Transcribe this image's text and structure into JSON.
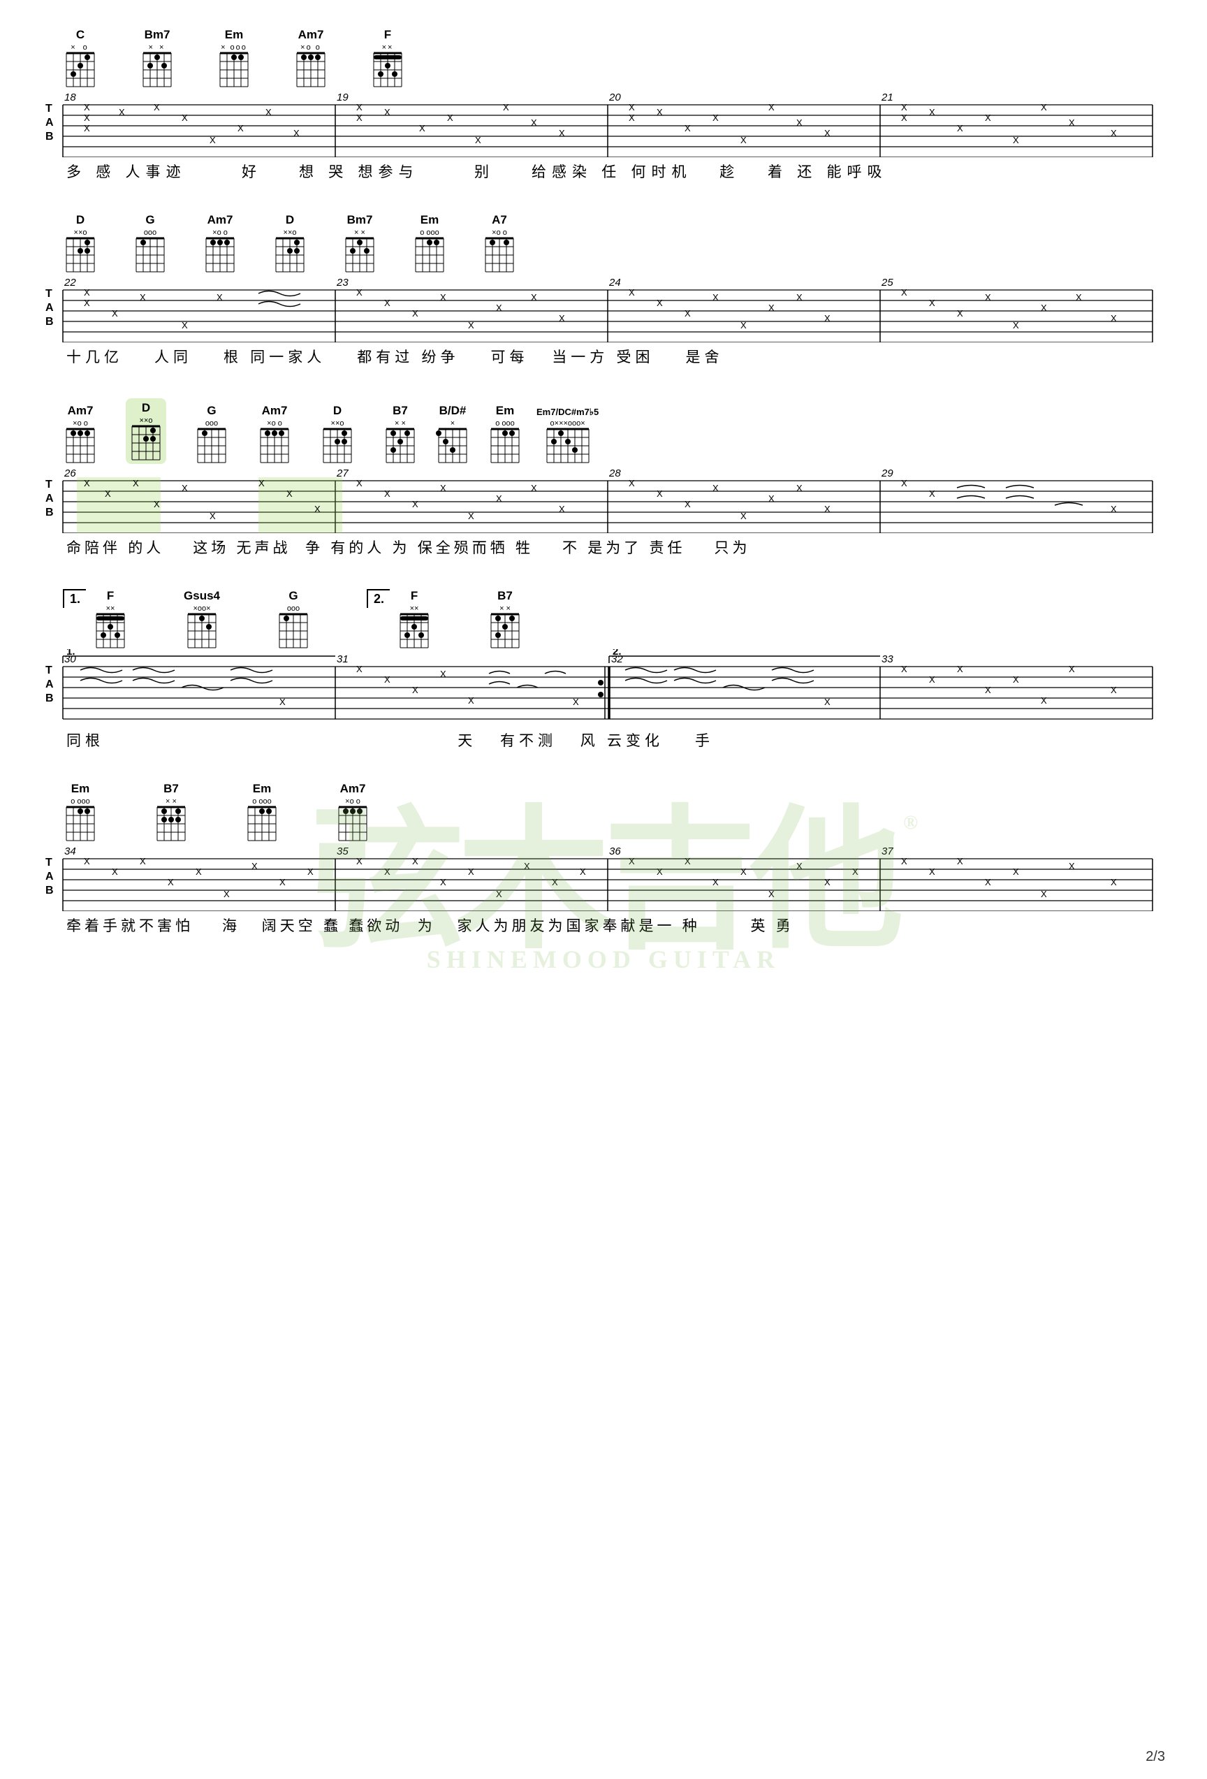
{
  "page": {
    "number": "2/3",
    "background": "#ffffff"
  },
  "watermark": {
    "big_text": "弦木吉他",
    "small_text": "SHINEMOOD GUITAR",
    "registered": "®"
  },
  "sections": [
    {
      "id": "section1",
      "chords": [
        {
          "name": "C",
          "markers": "×  o",
          "fret_marker": "",
          "position": "left"
        },
        {
          "name": "Bm7",
          "markers": "× ×",
          "fret_marker": "",
          "position": ""
        },
        {
          "name": "Em",
          "markers": "× ooo",
          "fret_marker": "",
          "position": ""
        },
        {
          "name": "Am7",
          "markers": "×o  o",
          "fret_marker": "",
          "position": ""
        },
        {
          "name": "F",
          "markers": "××",
          "fret_marker": "",
          "position": ""
        }
      ],
      "measures": [
        "18",
        "19",
        "20",
        "21"
      ],
      "lyrics": "多 感 人事迹      好    想 哭 想参与      别    给感染  任 何时机    趁    着 还 能呼吸"
    },
    {
      "id": "section2",
      "chords": [
        {
          "name": "D",
          "markers": "××o",
          "fret_marker": "",
          "position": ""
        },
        {
          "name": "G",
          "markers": "ooo",
          "fret_marker": "",
          "position": ""
        },
        {
          "name": "Am7",
          "markers": "×o  o",
          "fret_marker": "",
          "position": ""
        },
        {
          "name": "D",
          "markers": "××o",
          "fret_marker": "",
          "position": ""
        },
        {
          "name": "Bm7",
          "markers": "× ×",
          "fret_marker": "",
          "position": ""
        },
        {
          "name": "Em",
          "markers": "o ooo",
          "fret_marker": "",
          "position": ""
        },
        {
          "name": "A7",
          "markers": "×o  o",
          "fret_marker": "",
          "position": ""
        }
      ],
      "measures": [
        "22",
        "23",
        "24",
        "25"
      ],
      "lyrics": "十几亿    人同    根 同一家人    都有过  纷争    可每   当一方  受困    是舍"
    },
    {
      "id": "section3",
      "chords": [
        {
          "name": "Am7",
          "markers": "×o  o",
          "fret_marker": "",
          "position": ""
        },
        {
          "name": "D",
          "markers": "××o",
          "fret_marker": "",
          "position": "highlighted"
        },
        {
          "name": "G",
          "markers": "ooo",
          "fret_marker": "",
          "position": ""
        },
        {
          "name": "Am7",
          "markers": "×o  o",
          "fret_marker": "",
          "position": ""
        },
        {
          "name": "D",
          "markers": "××o",
          "fret_marker": "",
          "position": ""
        },
        {
          "name": "B7",
          "markers": "× ×",
          "fret_marker": "",
          "position": ""
        },
        {
          "name": "B/D#",
          "markers": "×",
          "fret_marker": "",
          "position": ""
        },
        {
          "name": "Em",
          "markers": "o ooo",
          "fret_marker": "",
          "position": ""
        },
        {
          "name": "Em7/DC#m7♭5",
          "markers": "o×××ooo×",
          "fret_marker": "",
          "position": ""
        }
      ],
      "measures": [
        "26",
        "27",
        "28",
        "29"
      ],
      "lyrics": "命陪伴  的人    这场  无声战   争 有的人  为  保全殒而牺 牲    不  是为了 责任    只为"
    },
    {
      "id": "section4",
      "chords": [
        {
          "name": "F",
          "markers": "××",
          "fret_marker": "",
          "ending": "1.",
          "position": ""
        },
        {
          "name": "Gsus4",
          "markers": "×oo×",
          "fret_marker": "",
          "position": ""
        },
        {
          "name": "G",
          "markers": "ooo",
          "fret_marker": "",
          "position": ""
        },
        {
          "name": "F",
          "markers": "××",
          "fret_marker": "",
          "ending": "2.",
          "position": ""
        },
        {
          "name": "B7",
          "markers": "× ×",
          "fret_marker": "",
          "position": ""
        }
      ],
      "measures": [
        "30",
        "31",
        "32",
        "33"
      ],
      "lyrics": "同根                                          天   有不测   风 云变化    手"
    },
    {
      "id": "section5",
      "chords": [
        {
          "name": "Em",
          "markers": "o ooo",
          "fret_marker": "",
          "position": ""
        },
        {
          "name": "B7",
          "markers": "× ×",
          "fret_marker": "",
          "position": ""
        },
        {
          "name": "Em",
          "markers": "o ooo",
          "fret_marker": "",
          "position": ""
        },
        {
          "name": "Am7",
          "markers": "×o  o",
          "fret_marker": "",
          "position": ""
        }
      ],
      "measures": [
        "34",
        "35",
        "36",
        "37"
      ],
      "lyrics": "牵着手就不害怕    海   阔天空  蠢 蠢欲动  为   家人为朋友为国家奉献是一  种       英 勇"
    }
  ]
}
